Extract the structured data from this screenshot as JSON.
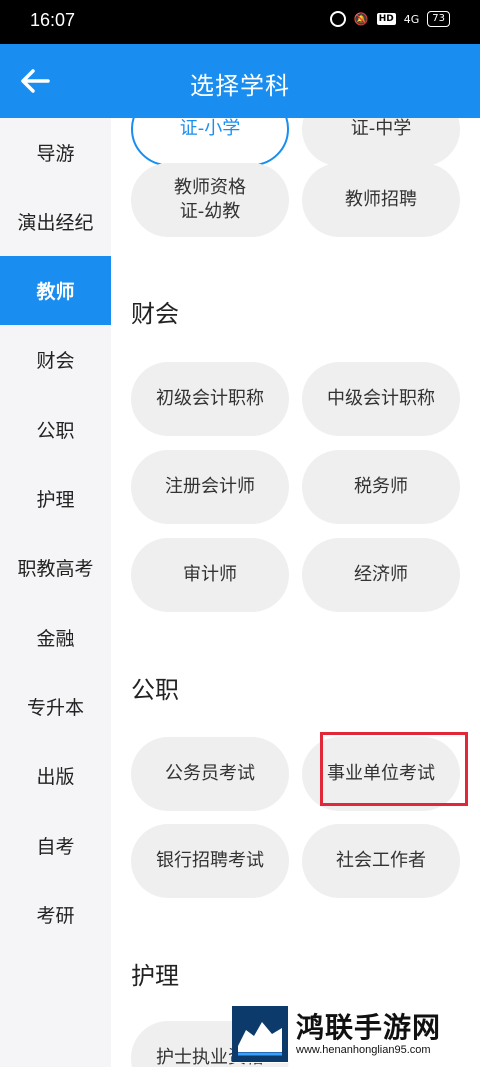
{
  "status_bar": {
    "time": "16:07",
    "hd": "HD",
    "signal": "4G",
    "battery": "73"
  },
  "app_bar": {
    "title": "选择学科"
  },
  "sidebar": {
    "items": [
      {
        "label": "导游"
      },
      {
        "label": "演出经纪"
      },
      {
        "label": "教师",
        "active": true
      },
      {
        "label": "财会"
      },
      {
        "label": "公职"
      },
      {
        "label": "护理"
      },
      {
        "label": "职教高考"
      },
      {
        "label": "金融"
      },
      {
        "label": "专升本"
      },
      {
        "label": "出版"
      },
      {
        "label": "自考"
      },
      {
        "label": "考研"
      }
    ]
  },
  "content": {
    "teacher": {
      "chips": [
        "证-小学",
        "证-中学",
        "教师资格\n证-幼教",
        "教师招聘"
      ]
    },
    "accounting": {
      "title": "财会",
      "chips": [
        "初级会计职称",
        "中级会计职称",
        "注册会计师",
        "税务师",
        "审计师",
        "经济师"
      ]
    },
    "civil": {
      "title": "公职",
      "chips": [
        "公务员考试",
        "事业单位考试",
        "银行招聘考试",
        "社会工作者"
      ]
    },
    "nursing": {
      "title": "护理",
      "chips": [
        "护士执业资格"
      ]
    }
  },
  "watermark": {
    "name": "鸿联手游网",
    "url": "www.henanhonglian95.com"
  },
  "colors": {
    "accent": "#1a8ef0",
    "highlight": "#e0283a",
    "chip_bg": "#efefef"
  }
}
